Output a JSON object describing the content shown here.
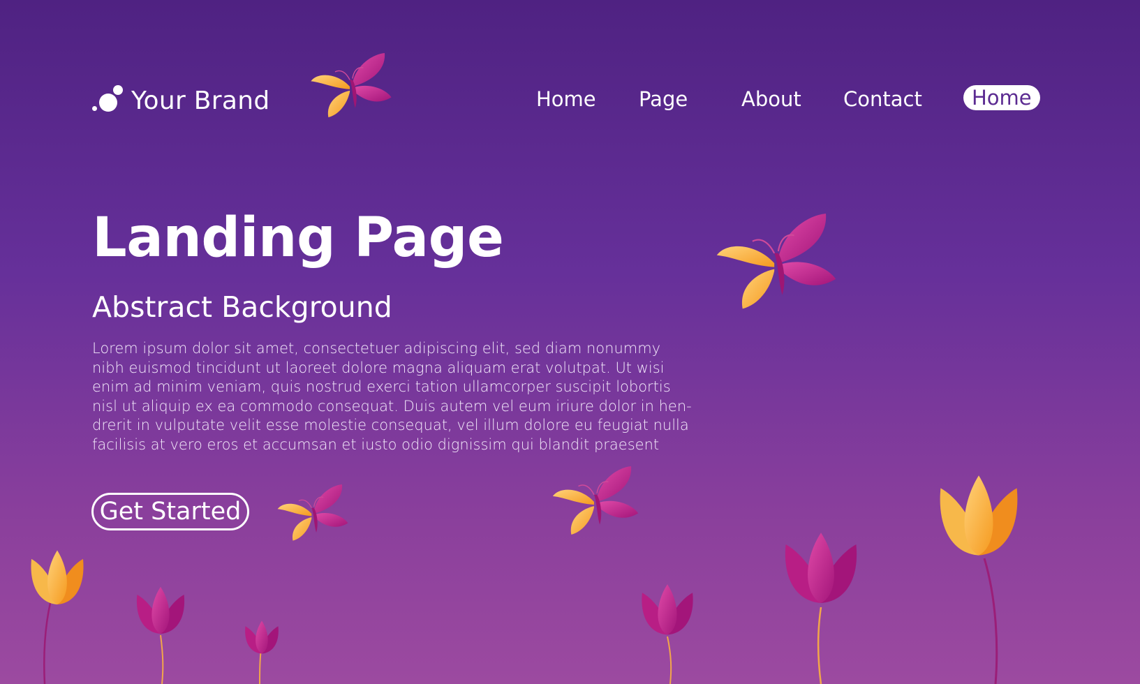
{
  "brand": {
    "name": "Your Brand",
    "logo_icon": "bubbles-logo-icon"
  },
  "nav": {
    "items": [
      "Home",
      "Page",
      "About",
      "Contact"
    ],
    "active": "Home"
  },
  "hero": {
    "title": "Landing Page",
    "subtitle": "Abstract Background",
    "body_lines": [
      "Lorem ipsum dolor sit amet, consectetuer adipiscing elit, sed diam nonummy",
      "nibh euismod tincidunt ut laoreet dolore magna aliquam erat volutpat. Ut wisi",
      "enim ad minim veniam, quis nostrud exerci tation ullamcorper suscipit lobortis",
      "nisl ut aliquip ex ea commodo consequat. Duis autem vel eum iriure dolor in hen-",
      "drerit in vulputate velit esse molestie consequat, vel illum dolore eu feugiat nulla",
      "facilisis at vero eros et accumsan et iusto odio dignissim qui blandit praesent"
    ],
    "cta_label": "Get Started"
  },
  "colors": {
    "bg_top": "#4f2282",
    "bg_bottom": "#9c4aa0",
    "petal_pink": "#c2258f",
    "petal_orange": "#f7a531",
    "text": "#ffffff",
    "active_nav_text": "#5b2a91"
  },
  "decorations": [
    "butterfly-icon",
    "tulip-icon"
  ]
}
